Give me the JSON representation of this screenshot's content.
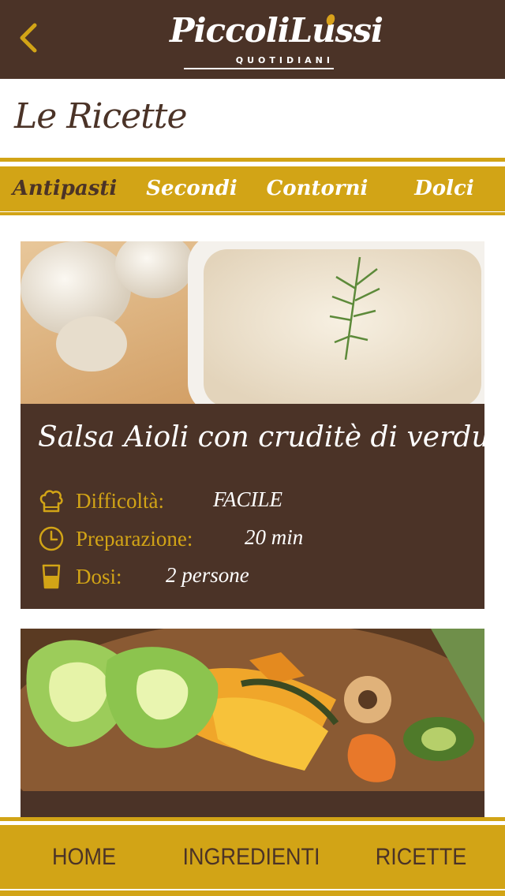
{
  "header": {
    "back_icon": "chevron-left-icon",
    "logo_brand": "PiccoliLussi",
    "logo_sub": "QUOTIDIANI"
  },
  "page": {
    "title": "Le Ricette"
  },
  "tabs": [
    {
      "label": "Antipasti",
      "active": true
    },
    {
      "label": "Secondi",
      "active": false
    },
    {
      "label": "Contorni",
      "active": false
    },
    {
      "label": "Dolci",
      "active": false
    }
  ],
  "recipes": [
    {
      "title": "Salsa Aioli con cruditè di verdure",
      "difficulty_label": "Difficoltà:",
      "difficulty_value": "FACILE",
      "prep_label": "Preparazione:",
      "prep_value": "20 min",
      "doses_label": "Dosi:",
      "doses_value": "2 persone",
      "image": "aioli-sauce-with-garlic"
    },
    {
      "title": "",
      "image": "vegetable-chips-bowl"
    }
  ],
  "bottom_nav": [
    {
      "label": "HOME"
    },
    {
      "label": "INGREDIENTI"
    },
    {
      "label": "RICETTE"
    }
  ],
  "colors": {
    "brown": "#4b3327",
    "gold": "#d2a416",
    "white": "#ffffff"
  }
}
